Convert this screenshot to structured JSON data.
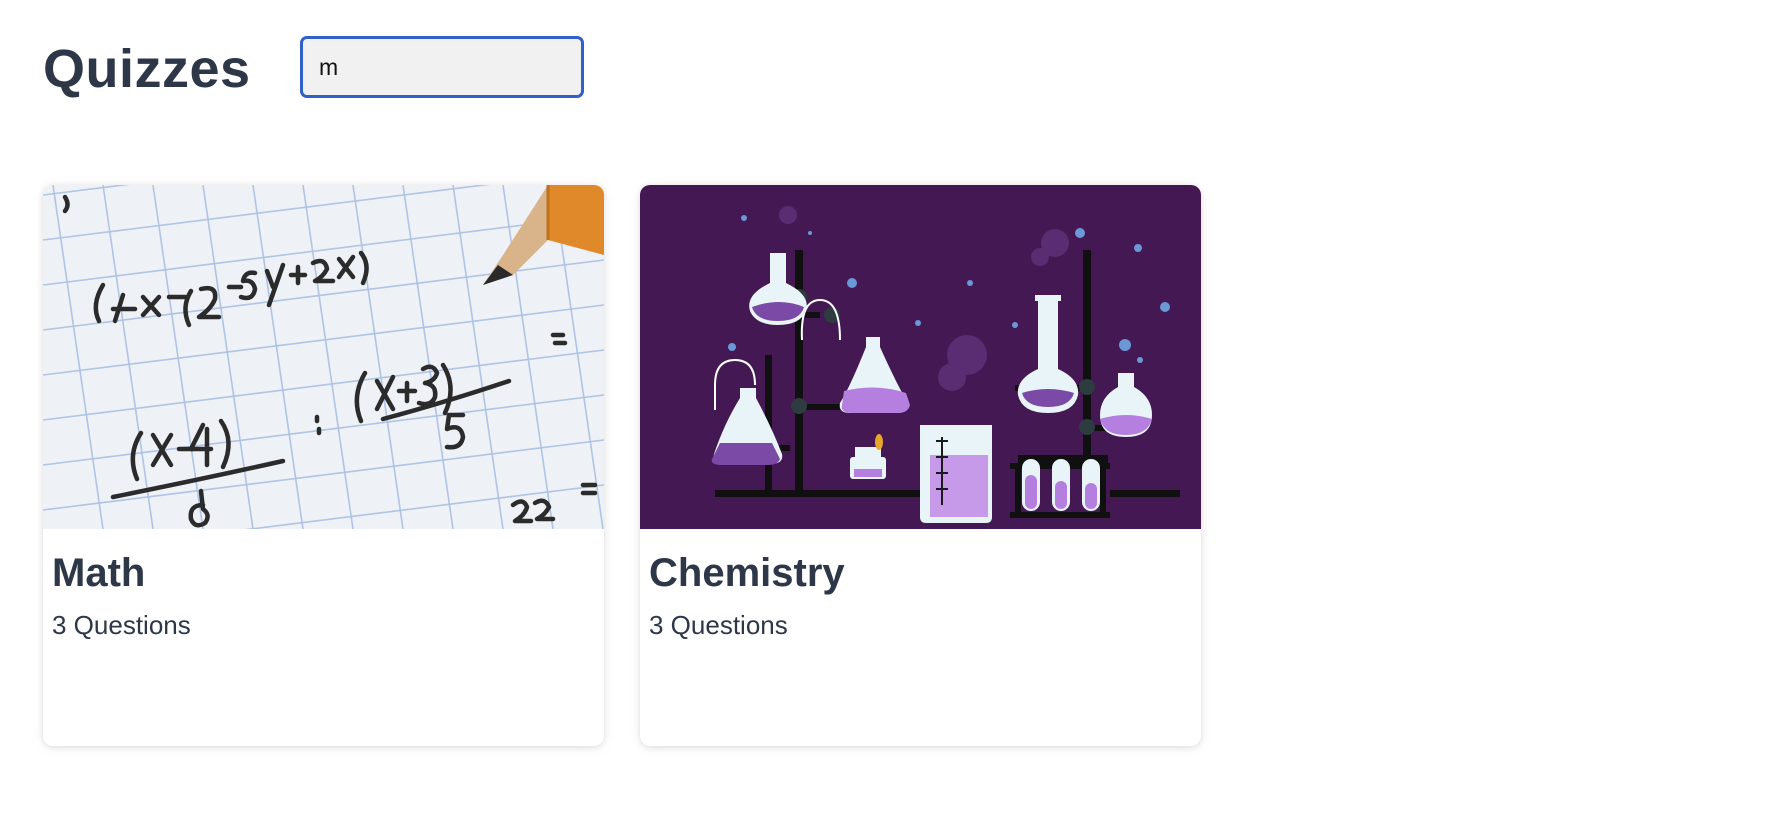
{
  "header": {
    "title": "Quizzes"
  },
  "search": {
    "value": "m"
  },
  "quizzes": [
    {
      "title": "Math",
      "questions": "3 Questions",
      "image_icon": "math-notebook-pencil-image"
    },
    {
      "title": "Chemistry",
      "questions": "3 Questions",
      "image_icon": "chemistry-lab-flasks-image"
    }
  ],
  "colors": {
    "text": "#2d3748",
    "input_border": "#3060c9",
    "chem_bg": "#431853",
    "chem_liquid": "#b57fdf"
  }
}
